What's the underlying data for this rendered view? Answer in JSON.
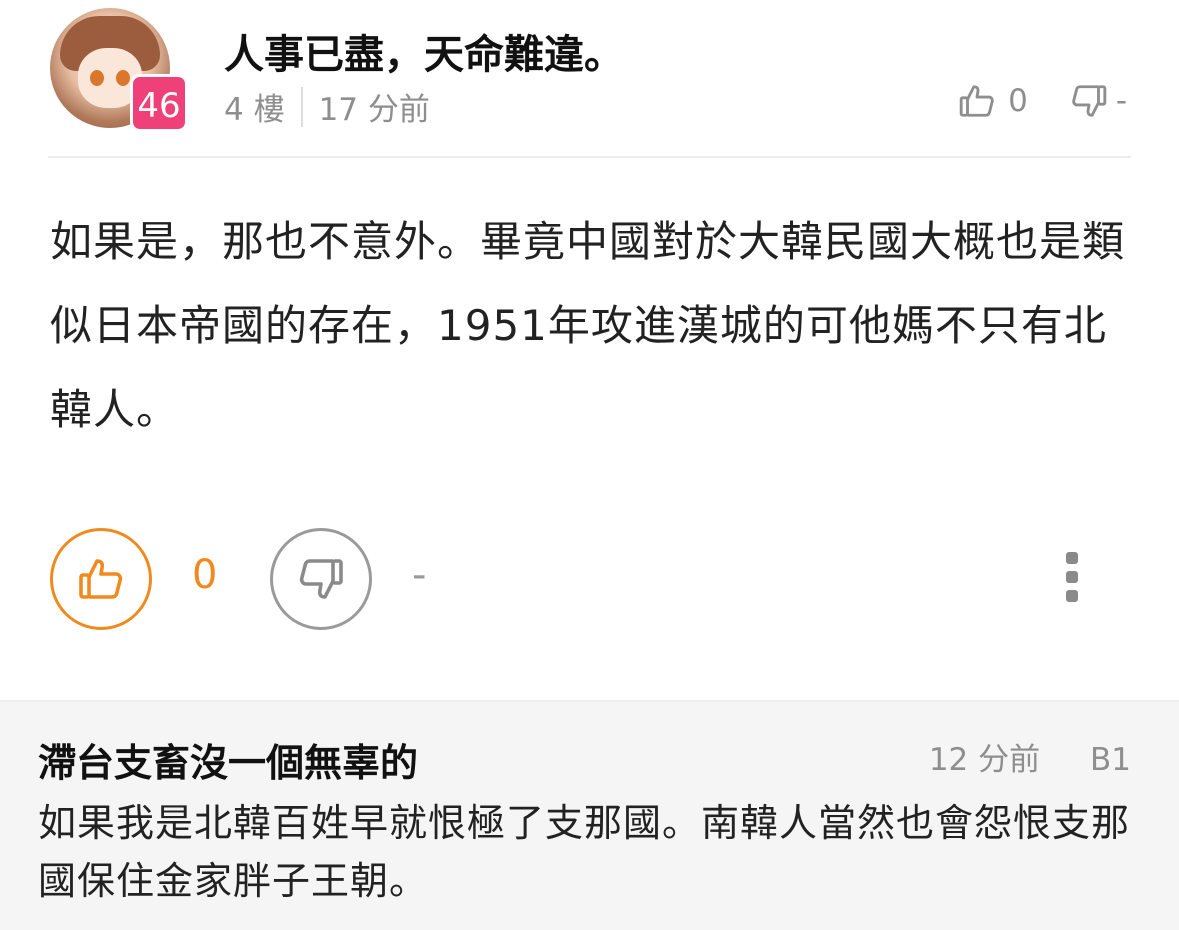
{
  "post": {
    "username": "人事已盡，天命難違。",
    "level": "46",
    "floor": "4 樓",
    "time": "17 分前",
    "header_like_count": "0",
    "header_dislike_count": "-",
    "body": "如果是，那也不意外。畢竟中國對於大韓民國大概也是類似日本帝國的存在，1951年攻進漢城的可他媽不只有北韓人。",
    "like_count": "0",
    "dislike_count": "-"
  },
  "reply": {
    "username": "滯台支畜沒一個無辜的",
    "time": "12 分前",
    "floor": "B1",
    "text": "如果我是北韓百姓早就恨極了支那國。南韓人當然也會怨恨支那國保住金家胖子王朝。"
  },
  "icons": {
    "like": "thumbs-up-icon",
    "dislike": "thumbs-down-icon",
    "more": "more-vertical-icon"
  },
  "colors": {
    "accent": "#f08a1e",
    "level_badge": "#f0407a",
    "muted": "#8e8e8e",
    "reply_bg": "#f5f5f5"
  }
}
